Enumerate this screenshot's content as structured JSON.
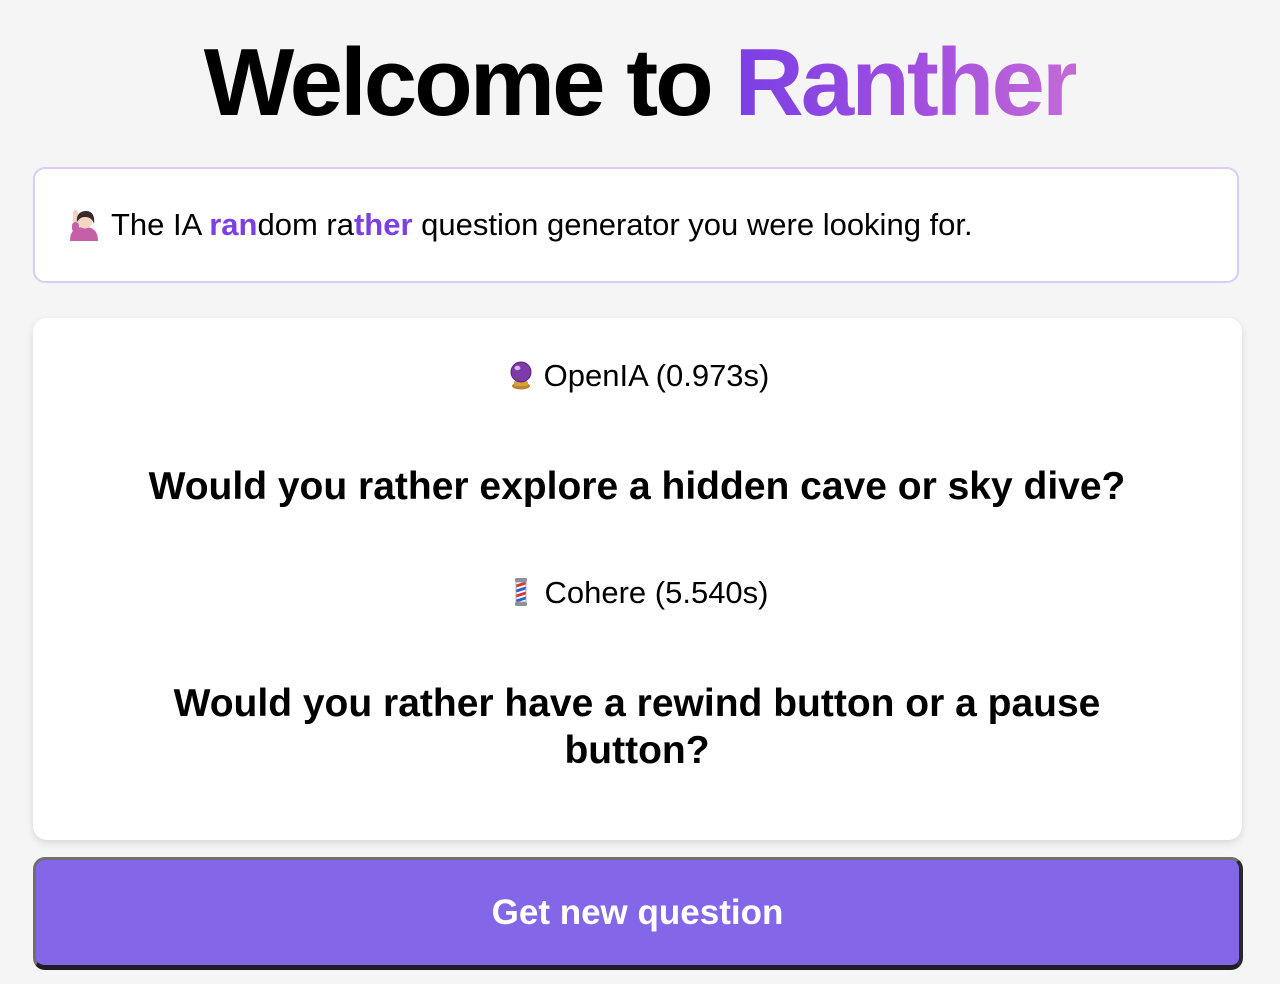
{
  "header": {
    "title_prefix": "Welcome to ",
    "title_brand": "Ranther"
  },
  "tagline": {
    "icon": "person-raising-hand-icon",
    "part1": "The IA ",
    "highlight1": "ran",
    "part2": "dom ra",
    "highlight2": "ther",
    "part3": " question generator you were looking for."
  },
  "results": [
    {
      "icon": "crystal-ball-icon",
      "provider": "OpenIA (0.973s)",
      "question": "Would you rather explore a hidden cave or sky dive?"
    },
    {
      "icon": "barber-pole-icon",
      "provider": "Cohere (5.540s)",
      "question": "Would you rather have a rewind button or a pause button?"
    }
  ],
  "actions": {
    "new_question_label": "Get new question"
  },
  "colors": {
    "accent": "#7b3fe4",
    "button": "#8467e8",
    "background": "#f5f5f5"
  }
}
